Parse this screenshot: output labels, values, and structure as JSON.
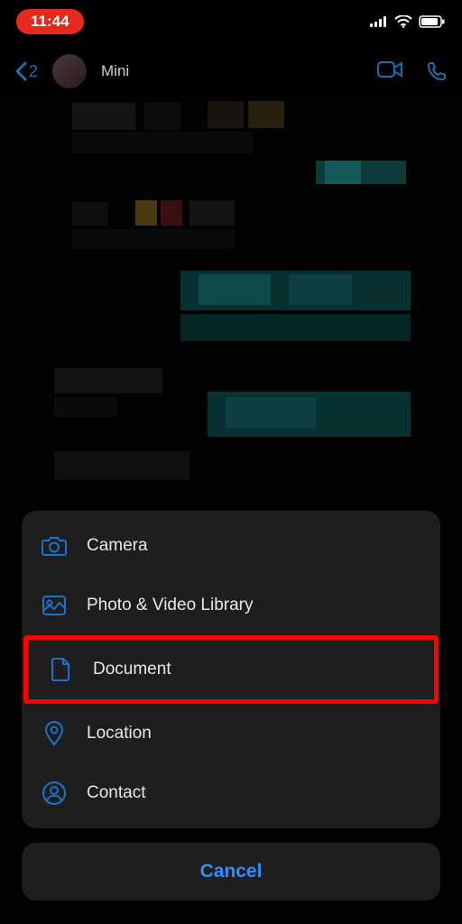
{
  "status": {
    "time": "11:44"
  },
  "header": {
    "back_badge": "2",
    "contact_name": "Mini"
  },
  "action_sheet": {
    "items": [
      {
        "icon": "camera-icon",
        "label": "Camera"
      },
      {
        "icon": "photo-icon",
        "label": "Photo & Video Library"
      },
      {
        "icon": "document-icon",
        "label": "Document",
        "highlighted": true
      },
      {
        "icon": "location-icon",
        "label": "Location"
      },
      {
        "icon": "contact-icon",
        "label": "Contact"
      }
    ],
    "cancel_label": "Cancel"
  },
  "colors": {
    "accent": "#2f8eff",
    "icon_blue": "#1a6fb0",
    "highlight": "#ff0000",
    "time_pill": "#e6291f"
  }
}
